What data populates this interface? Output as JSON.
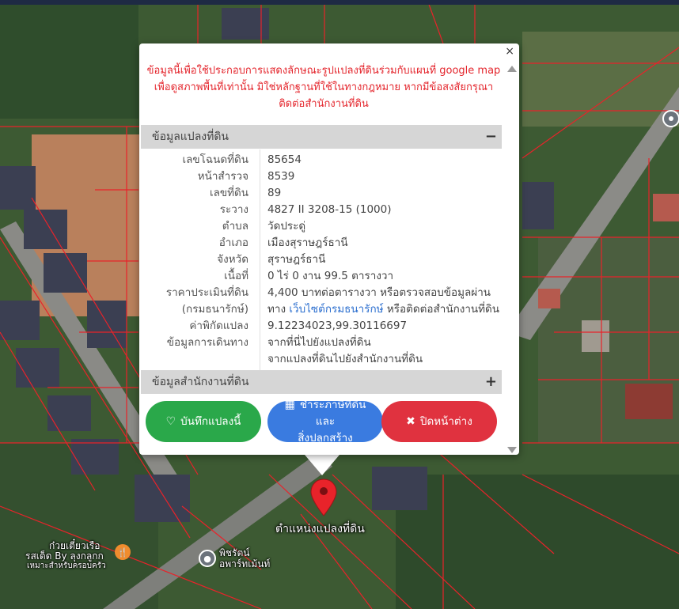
{
  "map": {
    "marker_label": "ตำแหน่งแปลงที่ดิน",
    "poi_1": {
      "line1": "ก๋วยเตี๋ยวเรือ",
      "line2": "รสเด็ด By ลุงกลูกก",
      "line3": "เหมาะสำหรับครอบครัว",
      "icon": "restaurant-icon",
      "color": "#f08c2e"
    },
    "poi_2": {
      "line1": "พิชรัตน์",
      "line2": "อพาร์ทเม้นท์",
      "icon": "apartment-icon"
    },
    "colors": {
      "parcel_line": "#e8232a",
      "marker": "#e8232a"
    }
  },
  "popup": {
    "close_label": "×",
    "disclaimer": "ข้อมูลนี้เพื่อใช้ประกอบการแสดงลักษณะรูปแปลงที่ดินร่วมกับแผนที่ google map เพื่อดูสภาพพื้นที่เท่านั้น มิใช่หลักฐานที่ใช้ในทางกฎหมาย หากมีข้อสงสัยกรุณาติดต่อสำนักงานที่ดิน",
    "section_parcel": {
      "title": "ข้อมูลแปลงที่ดิน",
      "toggle": "−"
    },
    "section_office": {
      "title": "ข้อมูลสำนักงานที่ดิน",
      "toggle": "+"
    },
    "rows": [
      {
        "label": "เลขโฉนดที่ดิน",
        "value": "85654"
      },
      {
        "label": "หน้าสำรวจ",
        "value": "8539"
      },
      {
        "label": "เลขที่ดิน",
        "value": "89"
      },
      {
        "label": "ระวาง",
        "value": "4827 II 3208-15 (1000)"
      },
      {
        "label": "ตำบล",
        "value": "วัดประดู่"
      },
      {
        "label": "อำเภอ",
        "value": "เมืองสุราษฎร์ธานี"
      },
      {
        "label": "จังหวัด",
        "value": "สุราษฎร์ธานี"
      },
      {
        "label": "เนื้อที่",
        "value": "0 ไร่ 0 งาน 99.5 ตารางวา"
      }
    ],
    "price": {
      "label1": "ราคาประเมินที่ดิน",
      "label2": "(กรมธนารักษ์)",
      "value1": "4,400 บาทต่อตารางวา หรือตรวจสอบข้อมูลผ่าน",
      "value2_pre": "ทาง ",
      "value2_link": "เว็บไซต์กรมธนารักษ์",
      "value2_post": " หรือติดต่อสำนักงานที่ดิน"
    },
    "coord": {
      "label": "ค่าพิกัดแปลง",
      "value": "9.12234023,99.30116697"
    },
    "directions": {
      "label": "ข้อมูลการเดินทาง",
      "link1": "จากที่นี่ไปยังแปลงที่ดิน",
      "link2": "จากแปลงที่ดินไปยังสำนักงานที่ดิน"
    },
    "buttons": {
      "save": "บันทึกแปลงนี้",
      "tax_line1": "ชำระภาษีที่ดินและ",
      "tax_line2": "สิ่งปลูกสร้าง",
      "close": "ปิดหน้าต่าง"
    }
  }
}
